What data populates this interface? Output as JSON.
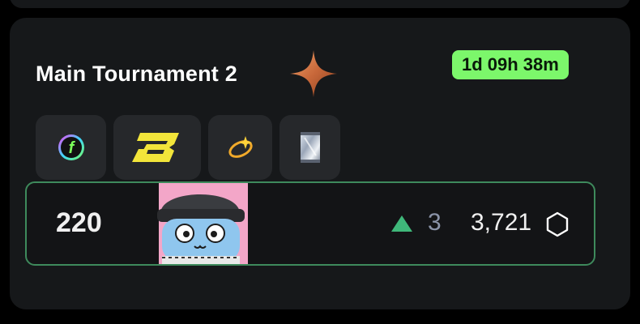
{
  "tournament": {
    "title": "Main Tournament 2",
    "timer": "1d 09h 38m",
    "sparkle_icon": "sparkle-icon",
    "badges": [
      {
        "icon": "f-token-icon"
      },
      {
        "icon": "b-logo-icon"
      },
      {
        "icon": "dizzy-icon"
      },
      {
        "icon": "card-pack-icon"
      }
    ]
  },
  "entry": {
    "rank": "220",
    "trend_icon": "triangle-up-icon",
    "trend_value": "3",
    "score": "3,721",
    "currency_icon": "hexagon-icon",
    "avatar_icon": "cat-avatar"
  },
  "colors": {
    "timer_bg": "#7cf76b",
    "row_border": "#3e8a5c",
    "trend_up": "#3fb87a",
    "card_bg": "#16181a",
    "badge_bg": "#26282b"
  }
}
